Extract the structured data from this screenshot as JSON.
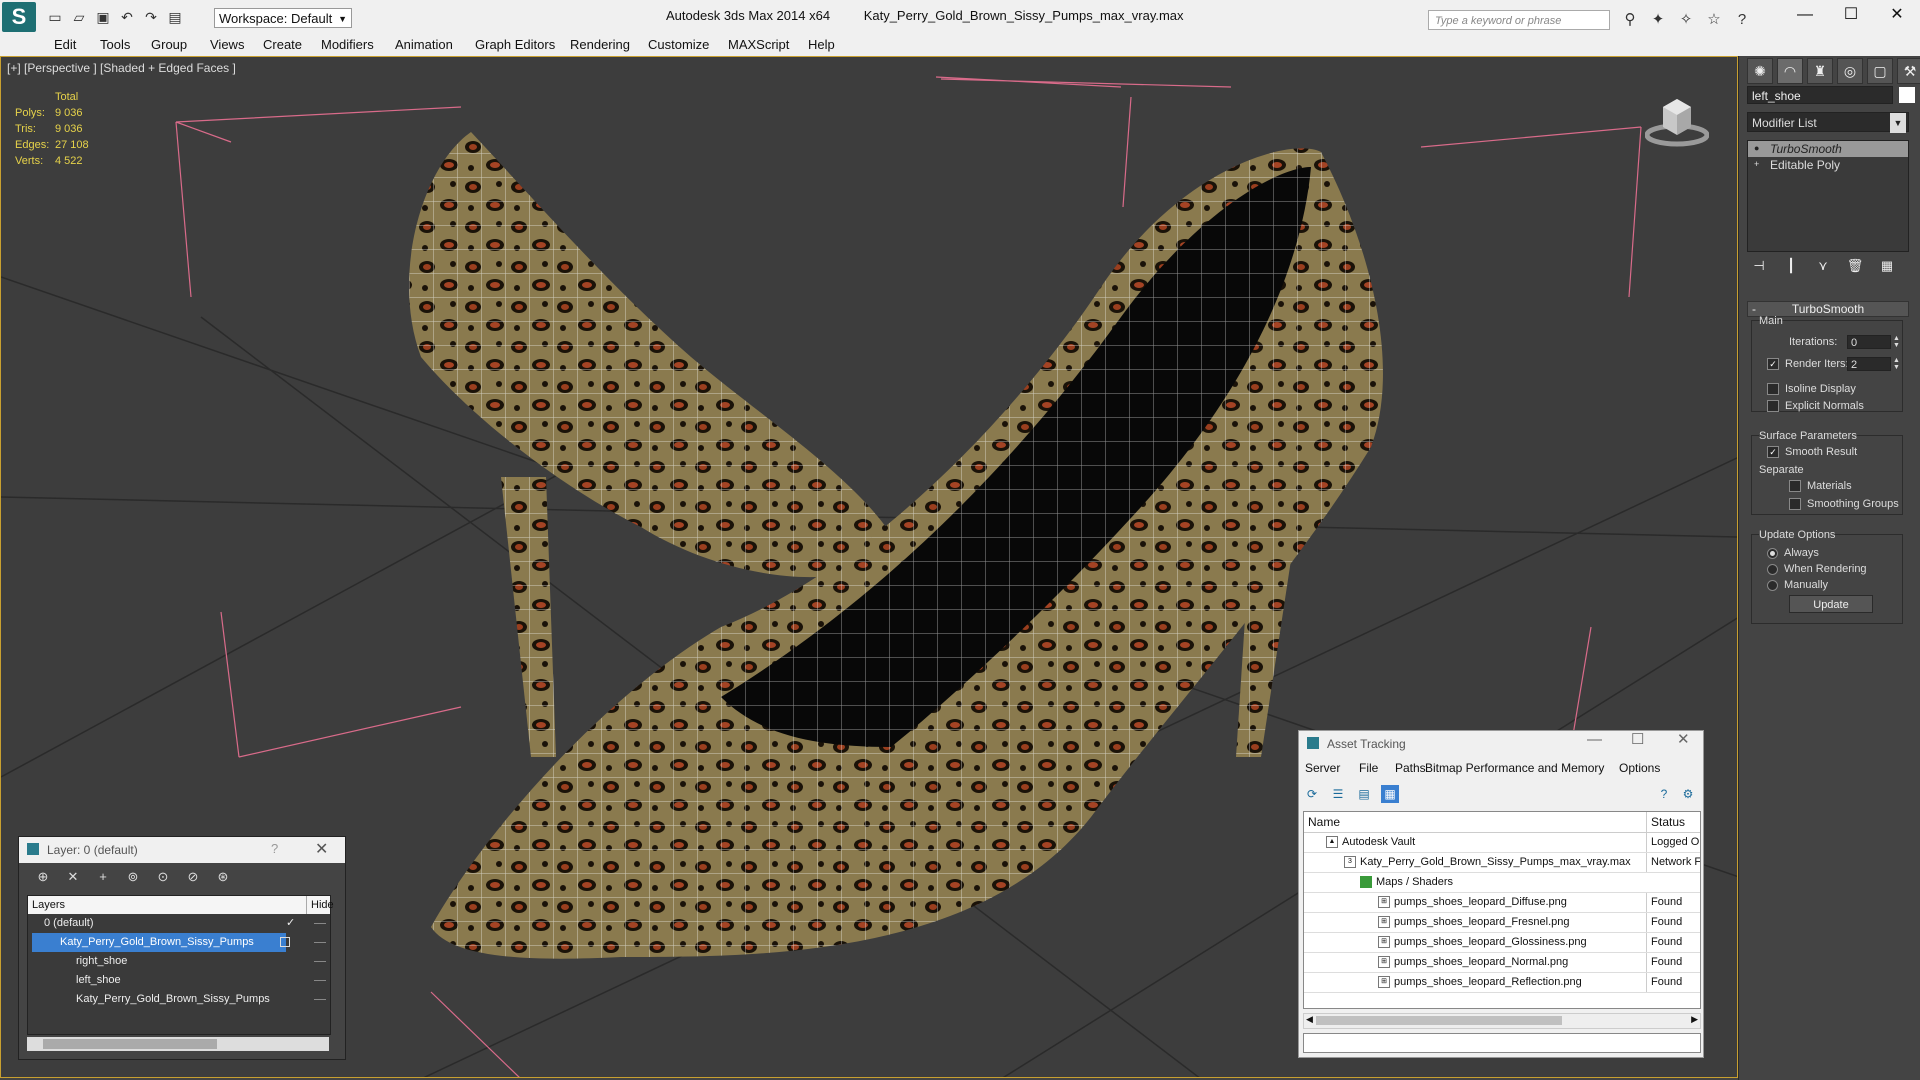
{
  "titlebar": {
    "logo": "S",
    "workspace": "Workspace: Default",
    "app_title": "Autodesk 3ds Max  2014 x64",
    "file_title": "Katy_Perry_Gold_Brown_Sissy_Pumps_max_vray.max",
    "search_placeholder": "Type a keyword or phrase"
  },
  "menu": [
    "Edit",
    "Tools",
    "Group",
    "Views",
    "Create",
    "Modifiers",
    "Animation",
    "Graph Editors",
    "Rendering",
    "Customize",
    "MAXScript",
    "Help"
  ],
  "viewport": {
    "label": "[+] [Perspective ] [Shaded + Edged Faces ]",
    "stats": {
      "header": "Total",
      "rows": [
        {
          "k": "Polys:",
          "v": "9 036"
        },
        {
          "k": "Tris:",
          "v": "9 036"
        },
        {
          "k": "Edges:",
          "v": "27 108"
        },
        {
          "k": "Verts:",
          "v": "4 522"
        }
      ]
    }
  },
  "command_panel": {
    "object_name": "left_shoe",
    "modifier_list": "Modifier List",
    "stack": [
      "TurboSmooth",
      "Editable Poly"
    ],
    "rollout": "TurboSmooth",
    "main_label": "Main",
    "iterations_label": "Iterations:",
    "iterations_value": "0",
    "render_iters_label": "Render Iters:",
    "render_iters_value": "2",
    "isoline": "Isoline Display",
    "explicit_normals": "Explicit Normals",
    "surface_params": "Surface Parameters",
    "smooth_result": "Smooth Result",
    "separate": "Separate",
    "materials": "Materials",
    "smoothing_groups": "Smoothing Groups",
    "update_options": "Update Options",
    "always": "Always",
    "when_rendering": "When Rendering",
    "manually": "Manually",
    "update_btn": "Update"
  },
  "layer_explorer": {
    "title": "Layer: 0 (default)",
    "help": "?",
    "col_layers": "Layers",
    "col_hide": "Hide",
    "rows": [
      {
        "label": "0 (default)",
        "level": 1
      },
      {
        "label": "Katy_Perry_Gold_Brown_Sissy_Pumps",
        "level": 1,
        "selected": true
      },
      {
        "label": "right_shoe",
        "level": 2
      },
      {
        "label": "left_shoe",
        "level": 2
      },
      {
        "label": "Katy_Perry_Gold_Brown_Sissy_Pumps",
        "level": 2
      }
    ]
  },
  "asset_tracking": {
    "title": "Asset Tracking",
    "menu": [
      "Server",
      "File",
      "Paths",
      "Bitmap Performance and Memory",
      "Options"
    ],
    "col_name": "Name",
    "col_status": "Status",
    "rows": [
      {
        "name": "Autodesk Vault",
        "status": "Logged O",
        "level": 1
      },
      {
        "name": "Katy_Perry_Gold_Brown_Sissy_Pumps_max_vray.max",
        "status": "Network F",
        "level": 2
      },
      {
        "name": "Maps / Shaders",
        "status": "",
        "level": 3
      },
      {
        "name": "pumps_shoes_leopard_Diffuse.png",
        "status": "Found",
        "level": 4
      },
      {
        "name": "pumps_shoes_leopard_Fresnel.png",
        "status": "Found",
        "level": 4
      },
      {
        "name": "pumps_shoes_leopard_Glossiness.png",
        "status": "Found",
        "level": 4
      },
      {
        "name": "pumps_shoes_leopard_Normal.png",
        "status": "Found",
        "level": 4
      },
      {
        "name": "pumps_shoes_leopard_Reflection.png",
        "status": "Found",
        "level": 4
      }
    ]
  },
  "colors": {
    "viewport_bg": "#3d3d3d",
    "active_border": "#c8a030",
    "stats_text": "#e6d24a",
    "selection": "#3a7fd0"
  }
}
